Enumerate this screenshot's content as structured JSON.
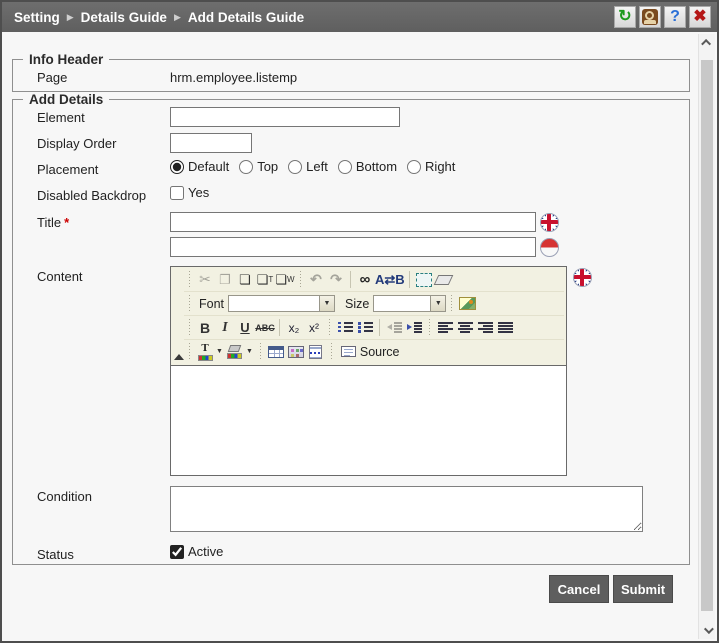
{
  "header": {
    "breadcrumb": [
      "Setting",
      "Details Guide",
      "Add Details Guide"
    ],
    "separator": "▶",
    "tools": {
      "refresh_glyph": "↻",
      "help_glyph": "?",
      "close_glyph": "✖"
    }
  },
  "sections": {
    "info_header": {
      "legend": "Info Header",
      "page": {
        "label": "Page",
        "value": "hrm.employee.listemp"
      }
    },
    "add_details": {
      "legend": "Add Details",
      "element": {
        "label": "Element",
        "value": ""
      },
      "display_order": {
        "label": "Display Order",
        "value": ""
      },
      "placement": {
        "label": "Placement",
        "options": [
          "Default",
          "Top",
          "Left",
          "Bottom",
          "Right"
        ],
        "selected": "Default"
      },
      "disabled_backdrop": {
        "label": "Disabled Backdrop",
        "option": "Yes",
        "checked": false
      },
      "title": {
        "label": "Title",
        "required_marker": "*",
        "value_english": "",
        "value_indonesian": ""
      },
      "content": {
        "label": "Content",
        "value": ""
      },
      "condition": {
        "label": "Condition",
        "value": ""
      },
      "status": {
        "label": "Status",
        "option": "Active",
        "checked": true
      }
    }
  },
  "editor": {
    "font_label": "Font",
    "size_label": "Size",
    "source_label": "Source",
    "dropdown_arrow": "▼",
    "glyphs": {
      "cut": "✂",
      "copy": "❐",
      "paste": "❏",
      "paste_text_letter": "T",
      "paste_word_letter": "W",
      "undo": "↶",
      "redo": "↷",
      "find": "∞",
      "replace": "A⇄B",
      "bold": "B",
      "italic": "I",
      "underline": "U",
      "strikethrough": "ABC",
      "subscript": "x₂",
      "superscript": "x²",
      "text_color_letter": "T"
    }
  },
  "footer": {
    "cancel_label": "Cancel",
    "submit_label": "Submit"
  },
  "colors": {
    "titlebar_bg": "#666666",
    "titlebar_text": "#ffffff",
    "button_bg": "#5e5e5e",
    "toolbar_bg": "#f2f1e2",
    "required_red": "#cc0000"
  }
}
